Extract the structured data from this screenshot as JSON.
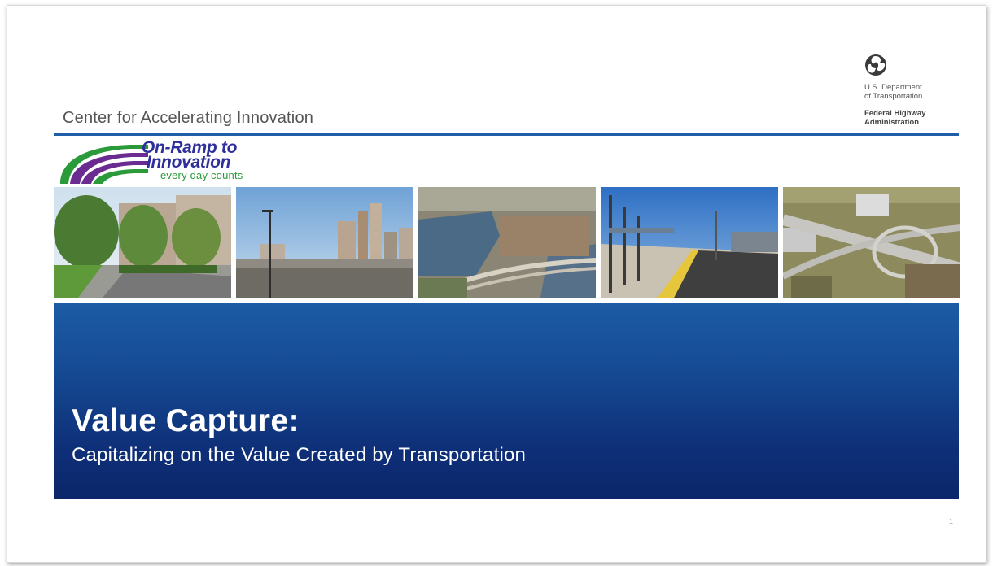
{
  "header": {
    "center_title": "Center for Accelerating Innovation"
  },
  "dot_logo": {
    "icon": "usdot-triskelion-icon",
    "line1": "U.S. Department",
    "line2": "of Transportation",
    "line3": "Federal Highway",
    "line4": "Administration"
  },
  "onramp_logo": {
    "line1": "On-Ramp to",
    "line2": "Innovation",
    "line3": "every day counts"
  },
  "photos": [
    {
      "subject": "tree-lined-pedestrian-street"
    },
    {
      "subject": "city-skyline-with-street-lamp"
    },
    {
      "subject": "aerial-river-city-with-bridge"
    },
    {
      "subject": "rail-transit-platform"
    },
    {
      "subject": "aerial-highway-interchange"
    }
  ],
  "banner": {
    "title": "Value Capture:",
    "subtitle": "Capitalizing on the Value Created by Transportation"
  },
  "colors": {
    "rule": "#1f5ea8",
    "banner_top": "#1d5ca6",
    "banner_bottom": "#0b2669",
    "onramp_blue": "#2f2f9c",
    "onramp_green": "#2a9a3a",
    "onramp_purple": "#6a2c91"
  },
  "page_number": "1"
}
